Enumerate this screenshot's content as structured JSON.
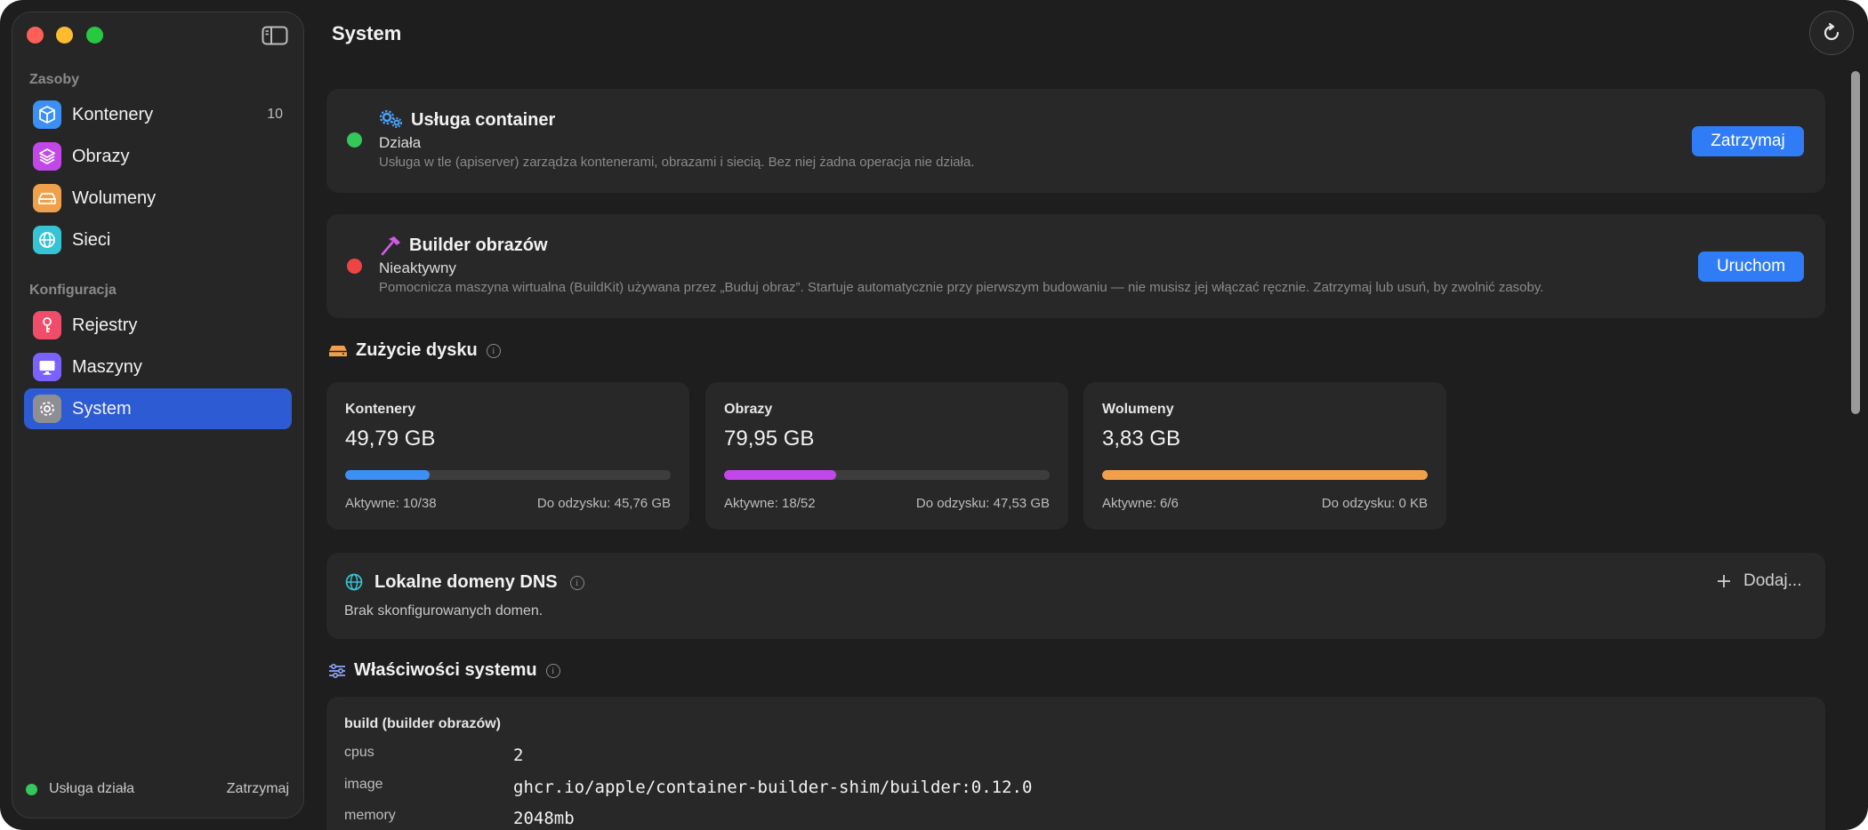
{
  "window": {
    "page_title": "System"
  },
  "sidebar": {
    "sections": [
      {
        "title": "Zasoby",
        "items": [
          {
            "label": "Kontenery",
            "icon": "cube-icon",
            "color": "#3b8ff5",
            "count": "10"
          },
          {
            "label": "Obrazy",
            "icon": "layers-icon",
            "color": "#c247e8"
          },
          {
            "label": "Wolumeny",
            "icon": "drive-icon",
            "color": "#f0a04b"
          },
          {
            "label": "Sieci",
            "icon": "globe-icon",
            "color": "#36c3d4"
          }
        ]
      },
      {
        "title": "Konfiguracja",
        "items": [
          {
            "label": "Rejestry",
            "icon": "key-icon",
            "color": "#ef4d6a"
          },
          {
            "label": "Maszyny",
            "icon": "monitor-icon",
            "color": "#7b61ff"
          },
          {
            "label": "System",
            "icon": "gear-icon",
            "color": "#8e8e93",
            "active": true
          }
        ]
      }
    ],
    "footer": {
      "status": "Usługa działa",
      "stop_label": "Zatrzymaj",
      "status_color": "#34c759"
    }
  },
  "services": [
    {
      "title": "Usługa container",
      "state": "Działa",
      "state_color": "#34c759",
      "description": "Usługa w tle (apiserver) zarządza kontenerami, obrazami i siecią. Bez niej żadna operacja nie działa.",
      "button": "Zatrzymaj",
      "icon": "gears-icon"
    },
    {
      "title": "Builder obrazów",
      "state": "Nieaktywny",
      "state_color": "#ef4444",
      "description": "Pomocnicza maszyna wirtualna (BuildKit) używana przez „Buduj obraz”. Startuje automatycznie przy pierwszym budowaniu — nie musisz jej włączać ręcznie. Zatrzymaj lub usuń, by zwolnić zasoby.",
      "button": "Uruchom",
      "icon": "hammer-icon"
    }
  ],
  "disk": {
    "title": "Zużycie dysku",
    "cards": [
      {
        "name": "Kontenery",
        "size": "49,79 GB",
        "fill": 0.26,
        "color": "#3b8ff5",
        "active": "Aktywne: 10/38",
        "reclaim": "Do odzysku: 45,76 GB"
      },
      {
        "name": "Obrazy",
        "size": "79,95 GB",
        "fill": 0.345,
        "color": "#c247e8",
        "active": "Aktywne: 18/52",
        "reclaim": "Do odzysku: 47,53 GB"
      },
      {
        "name": "Wolumeny",
        "size": "3,83 GB",
        "fill": 1.0,
        "color": "#f0a04b",
        "active": "Aktywne: 6/6",
        "reclaim": "Do odzysku: 0 KB"
      }
    ]
  },
  "dns": {
    "title": "Lokalne domeny DNS",
    "empty": "Brak skonfigurowanych domen.",
    "add_label": "Dodaj..."
  },
  "properties": {
    "title": "Właściwości systemu",
    "group": "build (builder obrazów)",
    "rows": [
      {
        "key": "cpus",
        "value": "2"
      },
      {
        "key": "image",
        "value": "ghcr.io/apple/container-builder-shim/builder:0.12.0"
      },
      {
        "key": "memory",
        "value": "2048mb"
      }
    ]
  }
}
